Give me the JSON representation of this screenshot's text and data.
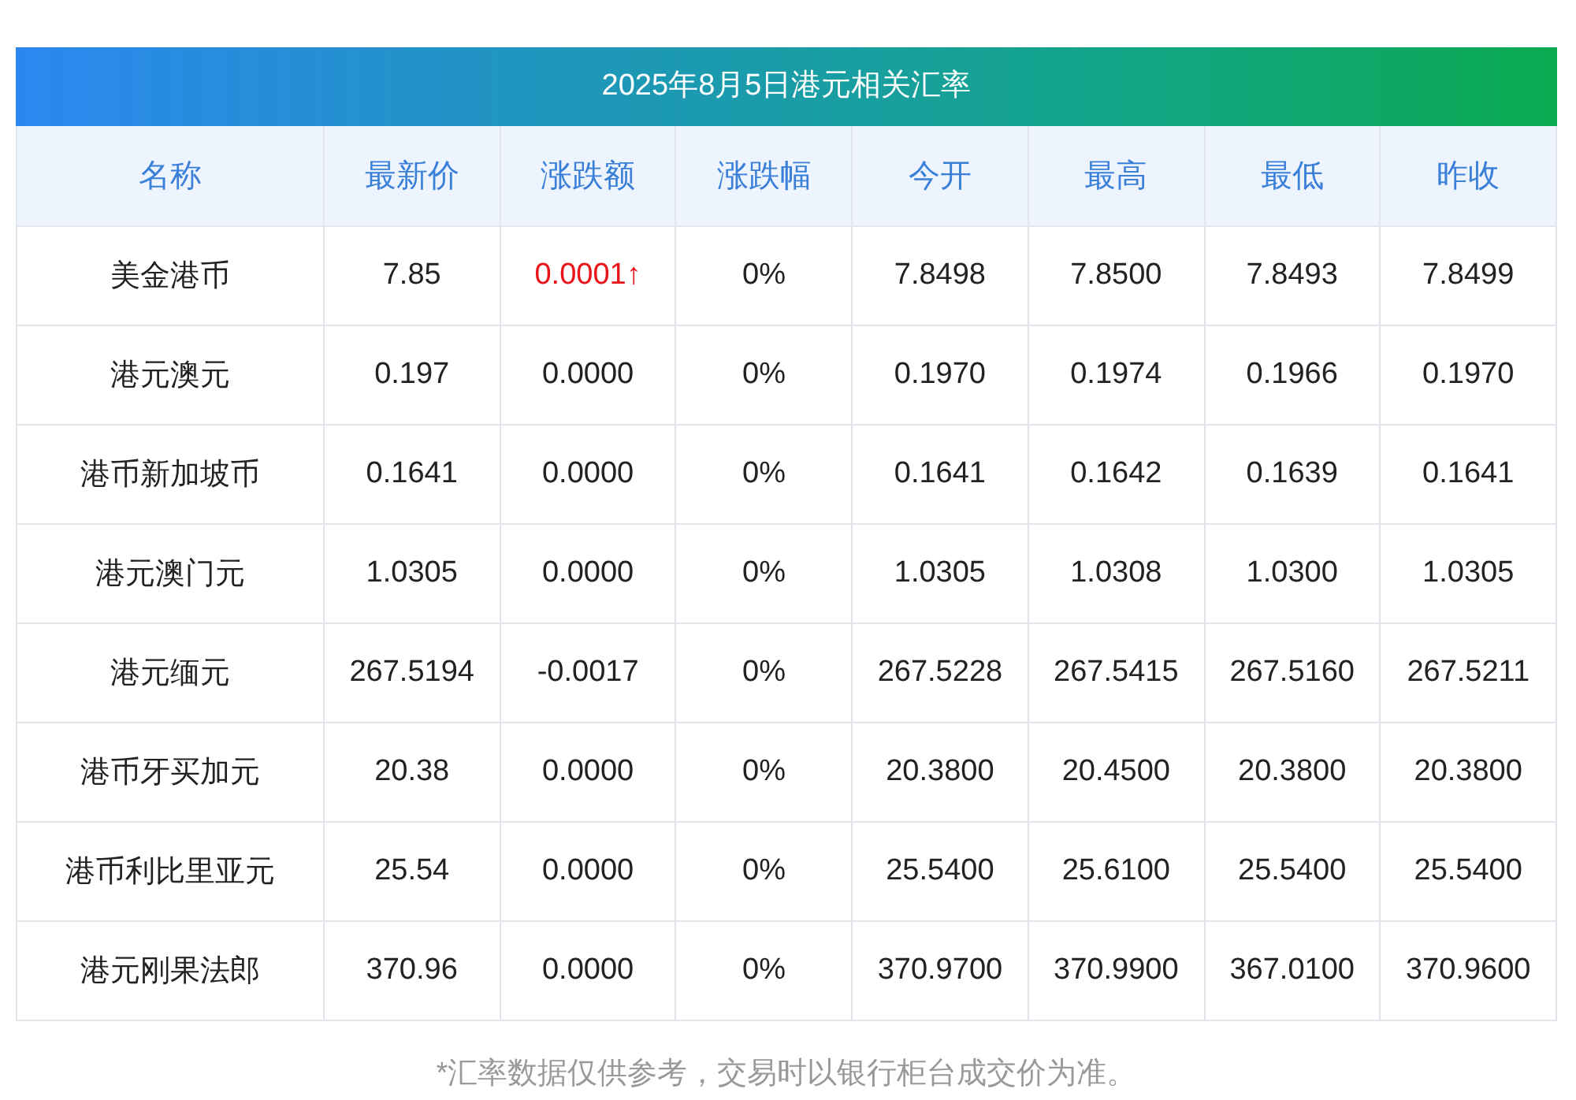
{
  "title": "2025年8月5日港元相关汇率",
  "columns": [
    "名称",
    "最新价",
    "涨跌额",
    "涨跌幅",
    "今开",
    "最高",
    "最低",
    "昨收"
  ],
  "rows": [
    {
      "cells": [
        "美金港币",
        "7.85",
        "0.0001↑",
        "0%",
        "7.8498",
        "7.8500",
        "7.8493",
        "7.8499"
      ],
      "rising": true
    },
    {
      "cells": [
        "港元澳元",
        "0.197",
        "0.0000",
        "0%",
        "0.1970",
        "0.1974",
        "0.1966",
        "0.1970"
      ],
      "rising": false
    },
    {
      "cells": [
        "港币新加坡币",
        "0.1641",
        "0.0000",
        "0%",
        "0.1641",
        "0.1642",
        "0.1639",
        "0.1641"
      ],
      "rising": false
    },
    {
      "cells": [
        "港元澳门元",
        "1.0305",
        "0.0000",
        "0%",
        "1.0305",
        "1.0308",
        "1.0300",
        "1.0305"
      ],
      "rising": false
    },
    {
      "cells": [
        "港元缅元",
        "267.5194",
        "-0.0017",
        "0%",
        "267.5228",
        "267.5415",
        "267.5160",
        "267.5211"
      ],
      "rising": false
    },
    {
      "cells": [
        "港币牙买加元",
        "20.38",
        "0.0000",
        "0%",
        "20.3800",
        "20.4500",
        "20.3800",
        "20.3800"
      ],
      "rising": false
    },
    {
      "cells": [
        "港币利比里亚元",
        "25.54",
        "0.0000",
        "0%",
        "25.5400",
        "25.6100",
        "25.5400",
        "25.5400"
      ],
      "rising": false
    },
    {
      "cells": [
        "港元刚果法郎",
        "370.96",
        "0.0000",
        "0%",
        "370.9700",
        "370.9900",
        "367.0100",
        "370.9600"
      ],
      "rising": false
    }
  ],
  "footnote": "*汇率数据仅供参考，交易时以银行柜台成交价为准。"
}
